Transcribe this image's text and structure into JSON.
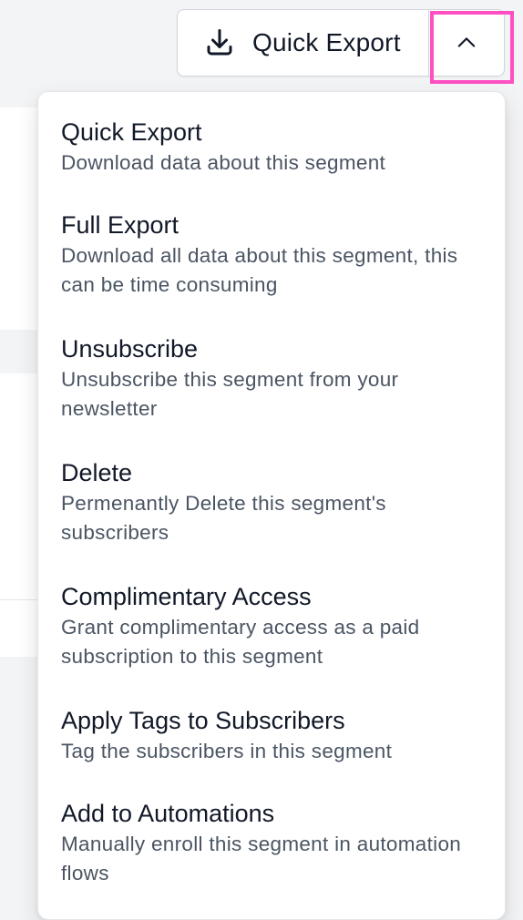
{
  "export_button": {
    "label": "Quick Export",
    "icon": "download-icon",
    "toggle_icon": "chevron-up-icon",
    "highlight_color": "#ff4fc3"
  },
  "menu": {
    "items": [
      {
        "title": "Quick Export",
        "description": "Download data about this segment"
      },
      {
        "title": "Full Export",
        "description": "Download all data about this segment, this can be time consuming"
      },
      {
        "title": "Unsubscribe",
        "description": "Unsubscribe this segment from your newsletter"
      },
      {
        "title": "Delete",
        "description": "Permenantly Delete this segment's subscribers"
      },
      {
        "title": "Complimentary Access",
        "description": "Grant complimentary access as a paid subscription to this segment"
      },
      {
        "title": "Apply Tags to Subscribers",
        "description": "Tag the subscribers in this segment"
      },
      {
        "title": "Add to Automations",
        "description": "Manually enroll this segment in automation flows"
      }
    ]
  }
}
